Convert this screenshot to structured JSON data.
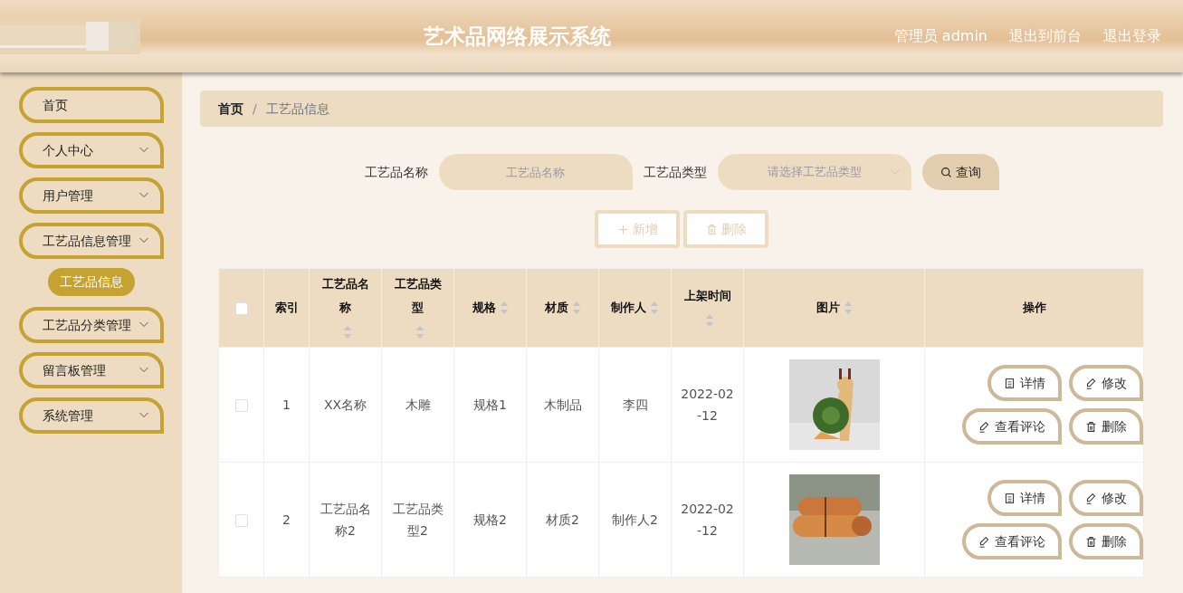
{
  "header": {
    "title": "艺术品网络展示系统",
    "links": [
      "管理员 admin",
      "退出到前台",
      "退出登录"
    ]
  },
  "sidebar": {
    "items": [
      {
        "label": "首页",
        "submenu": false
      },
      {
        "label": "个人中心",
        "submenu": true
      },
      {
        "label": "用户管理",
        "submenu": true
      },
      {
        "label": "工艺品信息管理",
        "submenu": true,
        "children": [
          {
            "label": "工艺品信息",
            "selected": true
          }
        ]
      },
      {
        "label": "工艺品分类管理",
        "submenu": true
      },
      {
        "label": "留言板管理",
        "submenu": true
      },
      {
        "label": "系统管理",
        "submenu": true
      }
    ]
  },
  "breadcrumb": {
    "separator": "/",
    "items": [
      "首页",
      "工艺品信息"
    ]
  },
  "search": {
    "name_label": "工艺品名称",
    "name_placeholder": "工艺品名称",
    "type_label": "工艺品类型",
    "type_placeholder": "请选择工艺品类型",
    "button": "查询"
  },
  "toolbar": [
    {
      "kind": "add",
      "label": "新增",
      "disabled": true
    },
    {
      "kind": "delete",
      "label": "删除",
      "disabled": true
    }
  ],
  "table": {
    "select_all_checked": false,
    "columns": [
      {
        "label": "索引",
        "sortable": false
      },
      {
        "label": "工艺品名称",
        "sortable": true
      },
      {
        "label": "工艺品类型",
        "sortable": true
      },
      {
        "label": "规格",
        "sortable": true
      },
      {
        "label": "材质",
        "sortable": true
      },
      {
        "label": "制作人",
        "sortable": true
      },
      {
        "label": "上架时间",
        "sortable": true
      },
      {
        "label": "图片",
        "sortable": true
      },
      {
        "label": "操作",
        "sortable": false
      }
    ],
    "rows": [
      {
        "checked": false,
        "cells": [
          "1",
          "XX名称",
          "木雕",
          "规格1",
          "木制品",
          "李四",
          "2022-02-12"
        ],
        "actions": [
          {
            "kind": "detail",
            "label": "详情"
          },
          {
            "kind": "edit",
            "label": "修改"
          },
          {
            "kind": "edit",
            "label": "查看评论"
          },
          {
            "kind": "delete",
            "label": "删除"
          }
        ]
      },
      {
        "checked": false,
        "cells": [
          "2",
          "工艺品名称2",
          "工艺品类型2",
          "规格2",
          "材质2",
          "制作人2",
          "2022-02-12"
        ],
        "actions": [
          {
            "kind": "detail",
            "label": "详情"
          },
          {
            "kind": "edit",
            "label": "修改"
          },
          {
            "kind": "edit",
            "label": "查看评论"
          },
          {
            "kind": "delete",
            "label": "删除"
          }
        ]
      }
    ]
  }
}
